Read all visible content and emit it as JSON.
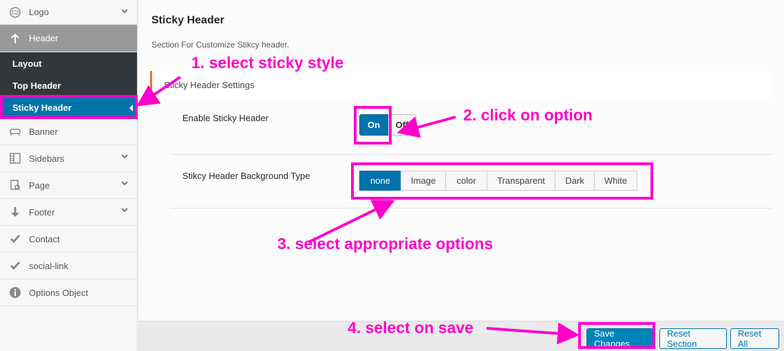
{
  "sidebar": {
    "items": [
      {
        "label": "Logo",
        "icon": "logo-icon",
        "has_children": true
      },
      {
        "label": "Header",
        "icon": "arrow-up-icon",
        "active": true
      },
      {
        "label": "Banner",
        "icon": "sofa-icon"
      },
      {
        "label": "Sidebars",
        "icon": "columns-icon",
        "has_children": true
      },
      {
        "label": "Page",
        "icon": "document-icon",
        "has_children": true
      },
      {
        "label": "Footer",
        "icon": "arrow-down-icon",
        "has_children": true
      },
      {
        "label": "Contact",
        "icon": "check-icon"
      },
      {
        "label": "social-link",
        "icon": "check-icon"
      },
      {
        "label": "Options Object",
        "icon": "info-icon"
      }
    ],
    "header_submenu": [
      {
        "label": "Layout"
      },
      {
        "label": "Top Header"
      },
      {
        "label": "Sticky Header",
        "current": true
      }
    ]
  },
  "main": {
    "title": "Sticky Header",
    "description": "Section For Customize Stikcy header.",
    "settings_heading": "Sticky Header Settings",
    "enable_label": "Enable Sticky Header",
    "switch_on": "On",
    "switch_off": "Off",
    "bg_type_label": "Stikcy Header Background Type",
    "bg_options": [
      "none",
      "Image",
      "color",
      "Transparent",
      "Dark",
      "White"
    ],
    "bg_selected": "none"
  },
  "footer": {
    "save": "Save Changes",
    "reset_section": "Reset Section",
    "reset_all": "Reset All"
  },
  "annotations": {
    "step1": "1. select sticky style",
    "step2": "2. click on option",
    "step3": "3. select appropriate options",
    "step4": "4. select on save"
  },
  "colors": {
    "accent": "#0073aa",
    "annotation": "#ff00cc",
    "section_marker": "#f56e28"
  }
}
